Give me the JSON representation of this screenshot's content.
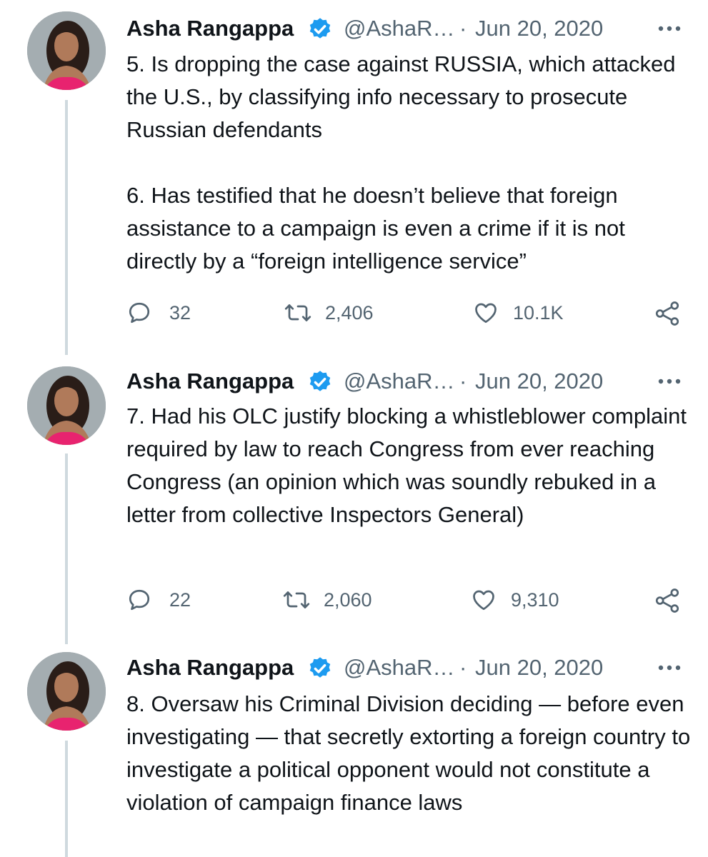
{
  "tweets": [
    {
      "author": {
        "name": "Asha Rangappa",
        "handle": "@AshaR…",
        "verified": true
      },
      "separator": "·",
      "date": "Jun 20, 2020",
      "text": "5. Is dropping the case against RUSSIA, which attacked the U.S., by classifying info necessary to prosecute Russian defendants\n\n6. Has testified that he doesn’t believe that foreign assistance to a campaign is even a crime if it is not directly by a “foreign intelligence service”",
      "replies": "32",
      "retweets": "2,406",
      "likes": "10.1K"
    },
    {
      "author": {
        "name": "Asha Rangappa",
        "handle": "@AshaR…",
        "verified": true
      },
      "separator": "·",
      "date": "Jun 20, 2020",
      "text": "7. Had his OLC justify blocking a whistleblower complaint required by law to reach Congress from ever reaching Congress (an opinion which was soundly rebuked in a letter from collective Inspectors General)",
      "replies": "22",
      "retweets": "2,060",
      "likes": "9,310"
    },
    {
      "author": {
        "name": "Asha Rangappa",
        "handle": "@AshaR…",
        "verified": true
      },
      "separator": "·",
      "date": "Jun 20, 2020",
      "text": "8. Oversaw his Criminal Division deciding — before even investigating — that secretly extorting a foreign country to investigate a political opponent would not constitute a violation of campaign finance laws"
    }
  ],
  "colors": {
    "verified_badge": "#1d9bf0",
    "secondary_text": "#536471",
    "thread_line": "#cfd9de",
    "primary_text": "#0f1419"
  },
  "icons": {
    "reply": "speech-bubble-icon",
    "retweet": "retweet-arrows-icon",
    "like": "heart-icon",
    "share": "share-nodes-icon",
    "more": "three-dots-icon",
    "verified": "verified-badge-icon"
  }
}
